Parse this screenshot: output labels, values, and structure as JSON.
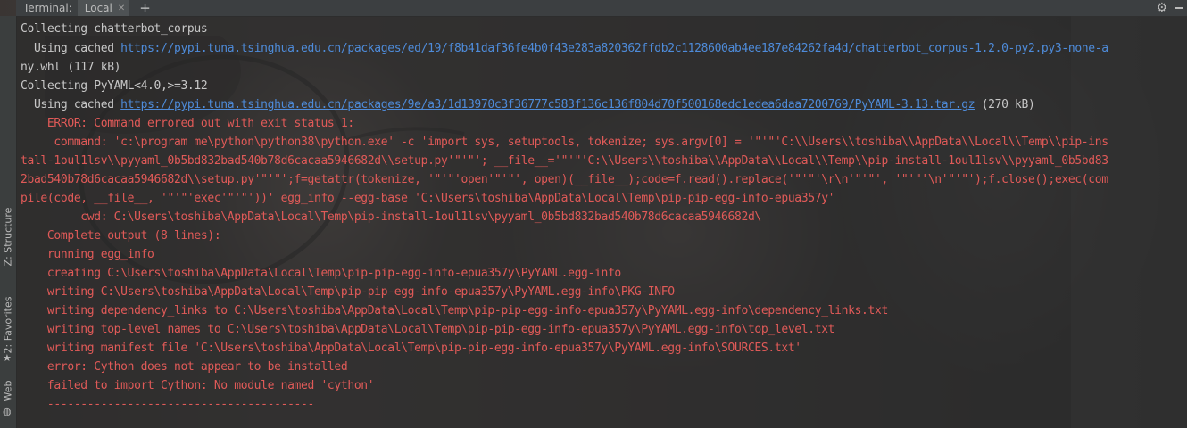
{
  "tabbar": {
    "title": "Terminal:",
    "tab_local": "Local",
    "close_glyph": "✕",
    "add_glyph": "+",
    "settings_icon": "gear-icon",
    "minimize_icon": "minimize-icon"
  },
  "side_toolbar": {
    "structure_label": "Z: Structure",
    "favorites_label": "2: Favorites",
    "web_label": "Web",
    "favorites_icon": "star-icon",
    "web_icon": "globe-icon"
  },
  "terminal": {
    "lines": [
      {
        "kind": "plain",
        "text": "Collecting chatterbot_corpus"
      },
      {
        "kind": "link",
        "prefix": "  Using cached ",
        "url": "https://pypi.tuna.tsinghua.edu.cn/packages/ed/19/f8b41daf36fe4b0f43e283a820362ffdb2c1128600ab4ee187e84262fa4d/chatterbot_corpus-1.2.0-py2.py3-none-a",
        "suffix": ""
      },
      {
        "kind": "plain",
        "text": "ny.whl (117 kB)"
      },
      {
        "kind": "plain",
        "text": "Collecting PyYAML<4.0,>=3.12"
      },
      {
        "kind": "link",
        "prefix": "  Using cached ",
        "url": "https://pypi.tuna.tsinghua.edu.cn/packages/9e/a3/1d13970c3f36777c583f136c136f804d70f500168edc1edea6daa7200769/PyYAML-3.13.tar.gz",
        "suffix": " (270 kB)"
      },
      {
        "kind": "err",
        "text": "    ERROR: Command errored out with exit status 1:"
      },
      {
        "kind": "err",
        "text": "     command: 'c:\\program me\\python\\python38\\python.exe' -c 'import sys, setuptools, tokenize; sys.argv[0] = '\"'\"'C:\\\\Users\\\\toshiba\\\\AppData\\\\Local\\\\Temp\\\\pip-ins"
      },
      {
        "kind": "err",
        "text": "tall-1oul1lsv\\\\pyyaml_0b5bd832bad540b78d6cacaa5946682d\\\\setup.py'\"'\"'; __file__='\"'\"'C:\\\\Users\\\\toshiba\\\\AppData\\\\Local\\\\Temp\\\\pip-install-1oul1lsv\\\\pyyaml_0b5bd83"
      },
      {
        "kind": "err",
        "text": "2bad540b78d6cacaa5946682d\\\\setup.py'\"'\"';f=getattr(tokenize, '\"'\"'open'\"'\"', open)(__file__);code=f.read().replace('\"'\"'\\r\\n'\"'\"', '\"'\"'\\n'\"'\"');f.close();exec(com"
      },
      {
        "kind": "err",
        "text": "pile(code, __file__, '\"'\"'exec'\"'\"'))' egg_info --egg-base 'C:\\Users\\toshiba\\AppData\\Local\\Temp\\pip-pip-egg-info-epua357y'"
      },
      {
        "kind": "err",
        "text": "         cwd: C:\\Users\\toshiba\\AppData\\Local\\Temp\\pip-install-1oul1lsv\\pyyaml_0b5bd832bad540b78d6cacaa5946682d\\"
      },
      {
        "kind": "err",
        "text": "    Complete output (8 lines):"
      },
      {
        "kind": "err",
        "text": "    running egg_info"
      },
      {
        "kind": "err",
        "text": "    creating C:\\Users\\toshiba\\AppData\\Local\\Temp\\pip-pip-egg-info-epua357y\\PyYAML.egg-info"
      },
      {
        "kind": "err",
        "text": "    writing C:\\Users\\toshiba\\AppData\\Local\\Temp\\pip-pip-egg-info-epua357y\\PyYAML.egg-info\\PKG-INFO"
      },
      {
        "kind": "err",
        "text": "    writing dependency_links to C:\\Users\\toshiba\\AppData\\Local\\Temp\\pip-pip-egg-info-epua357y\\PyYAML.egg-info\\dependency_links.txt"
      },
      {
        "kind": "err",
        "text": "    writing top-level names to C:\\Users\\toshiba\\AppData\\Local\\Temp\\pip-pip-egg-info-epua357y\\PyYAML.egg-info\\top_level.txt"
      },
      {
        "kind": "err",
        "text": "    writing manifest file 'C:\\Users\\toshiba\\AppData\\Local\\Temp\\pip-pip-egg-info-epua357y\\PyYAML.egg-info\\SOURCES.txt'"
      },
      {
        "kind": "err",
        "text": "    error: Cython does not appear to be installed"
      },
      {
        "kind": "err",
        "text": "    failed to import Cython: No module named 'cython'"
      },
      {
        "kind": "err",
        "text": "    ----------------------------------------"
      }
    ]
  }
}
